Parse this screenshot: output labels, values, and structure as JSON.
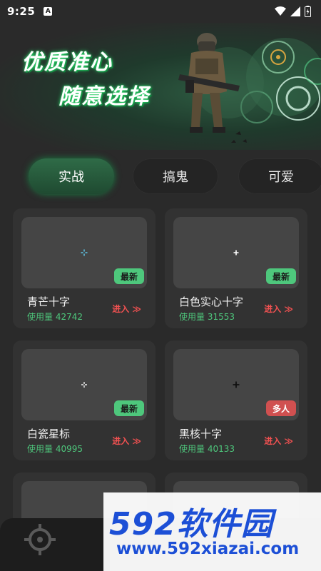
{
  "status_bar": {
    "time": "9:25",
    "notification_badge": "A"
  },
  "banner": {
    "line1": "优质准心",
    "line2": "随意选择"
  },
  "tabs": [
    {
      "label": "实战",
      "active": true
    },
    {
      "label": "搞鬼",
      "active": false
    },
    {
      "label": "可爱",
      "active": false
    }
  ],
  "cards": [
    {
      "title": "青芒十字",
      "usage": "使用量 42742",
      "enter": "进入 ≫",
      "badge": "最新",
      "badge_color": "green",
      "crosshair_color": "#5fc7e8"
    },
    {
      "title": "白色实心十字",
      "usage": "使用量 31553",
      "enter": "进入 ≫",
      "badge": "最新",
      "badge_color": "green",
      "crosshair_color": "#ffffff"
    },
    {
      "title": "白瓷星标",
      "usage": "使用量 40995",
      "enter": "进入 ≫",
      "badge": "最新",
      "badge_color": "green",
      "crosshair_color": "#f0f0f0"
    },
    {
      "title": "黑核十字",
      "usage": "使用量 40133",
      "enter": "进入 ≫",
      "badge": "多人",
      "badge_color": "red",
      "crosshair_color": "#111111"
    }
  ],
  "watermark": {
    "main": "592软件园",
    "url": "www.592xiazai.com"
  },
  "colors": {
    "accent_green": "#4ec77c",
    "enter_red": "#f15151",
    "badge_red": "#d05050"
  }
}
